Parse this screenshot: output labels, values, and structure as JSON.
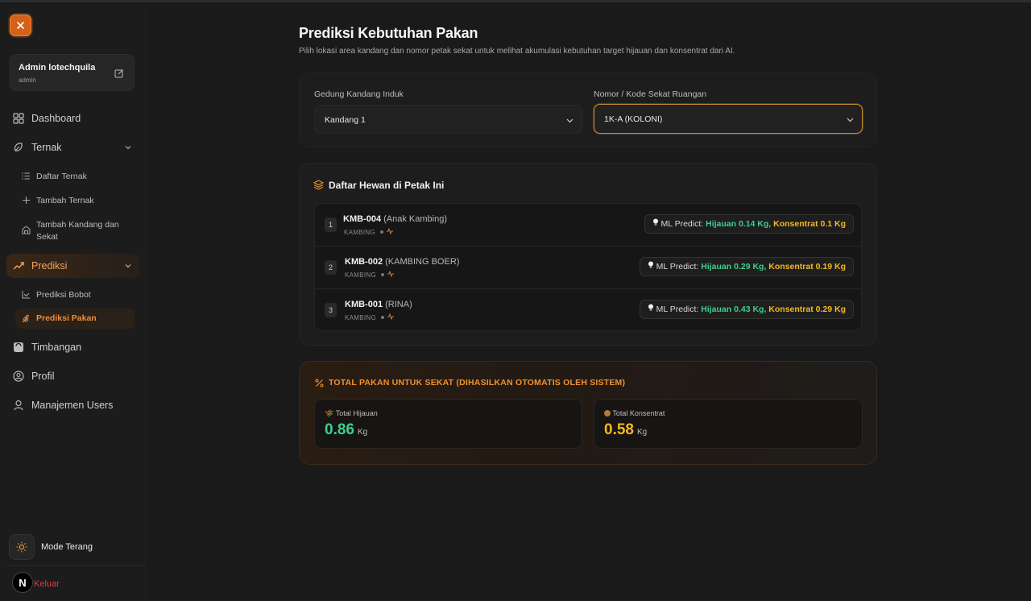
{
  "sidebar": {
    "user": {
      "name": "Admin lotechquila",
      "role": "admin"
    },
    "nav": {
      "dashboard": "Dashboard",
      "ternak": "Ternak",
      "daftar_ternak": "Daftar Ternak",
      "tambah_ternak": "Tambah Ternak",
      "tambah_kandang": "Tambah Kandang dan Sekat",
      "prediksi": "Prediksi",
      "prediksi_bobot": "Prediksi Bobot",
      "prediksi_pakan": "Prediksi Pakan",
      "timbangan": "Timbangan",
      "profil": "Profil",
      "manajemen_users": "Manajemen Users"
    },
    "mode_label": "Mode Terang",
    "avatar_letter": "N",
    "logout": "Keluar"
  },
  "main": {
    "title": "Prediksi Kebutuhan Pakan",
    "subtitle": "Pilih lokasi area kandang dan nomor petak sekat untuk melihat akumulasi kebutuhan target hijauan dan konsentrat dari AI.",
    "filters": {
      "building_label": "Gedung Kandang Induk",
      "building_value": "Kandang 1",
      "pen_label": "Nomor / Kode Sekat Ruangan",
      "pen_value": "1K-A (KOLONI)"
    },
    "animals_title": "Daftar Hewan di Petak Ini",
    "animals": [
      {
        "no": "1",
        "code": "KMB-004",
        "name": "(Anak Kambing)",
        "type": "KAMBING",
        "predict_label": "ML Predict:",
        "hijauan": "Hijauan 0.14 Kg,",
        "konsentrat": "Konsentrat 0.1 Kg"
      },
      {
        "no": "2",
        "code": "KMB-002",
        "name": "(KAMBING BOER)",
        "type": "KAMBING",
        "predict_label": "ML Predict:",
        "hijauan": "Hijauan 0.29 Kg,",
        "konsentrat": "Konsentrat 0.19 Kg"
      },
      {
        "no": "3",
        "code": "KMB-001",
        "name": "(RINA)",
        "type": "KAMBING",
        "predict_label": "ML Predict:",
        "hijauan": "Hijauan 0.43 Kg,",
        "konsentrat": "Konsentrat 0.29 Kg"
      }
    ],
    "total": {
      "title": "TOTAL PAKAN UNTUK SEKAT (DIHASILKAN OTOMATIS OLEH SISTEM)",
      "hijauan_label": "Total Hijauan",
      "hijauan_value": "0.86",
      "konsentrat_label": "Total Konsentrat",
      "konsentrat_value": "0.58",
      "unit": "Kg"
    }
  },
  "colors": {
    "accent": "#f08c3c",
    "green": "#3ccf8e",
    "yellow": "#f5b820",
    "danger": "#e8373c"
  }
}
